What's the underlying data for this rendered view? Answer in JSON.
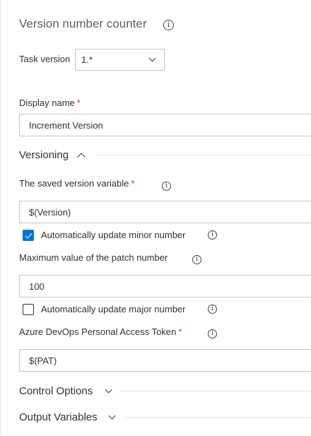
{
  "header": {
    "title": "Version number counter"
  },
  "task_version": {
    "label": "Task version",
    "value": "1.*"
  },
  "display_name": {
    "label": "Display name",
    "required_mark": "*",
    "value": "Increment Version"
  },
  "versioning": {
    "title": "Versioning",
    "saved_variable": {
      "label": "The saved version variable",
      "required_mark": "*",
      "value": "$(Version)"
    },
    "auto_minor": {
      "label": "Automatically update minor number",
      "checked": true
    },
    "max_patch": {
      "label": "Maximum value of the patch number",
      "value": "100"
    },
    "auto_major": {
      "label": "Automatically update major number",
      "checked": false
    },
    "pat": {
      "label": "Azure DevOps Personal Access Token",
      "required_mark": "*",
      "value": "$(PAT)"
    }
  },
  "control_options": {
    "title": "Control Options"
  },
  "output_variables": {
    "title": "Output Variables"
  },
  "colors": {
    "accent": "#0078d4",
    "required": "#c4314b",
    "border": "#c8c6c4"
  },
  "icons": {
    "info": "info-icon",
    "chevron_down": "chevron-down-icon",
    "chevron_up": "chevron-up-icon",
    "checkmark": "checkmark-icon"
  }
}
